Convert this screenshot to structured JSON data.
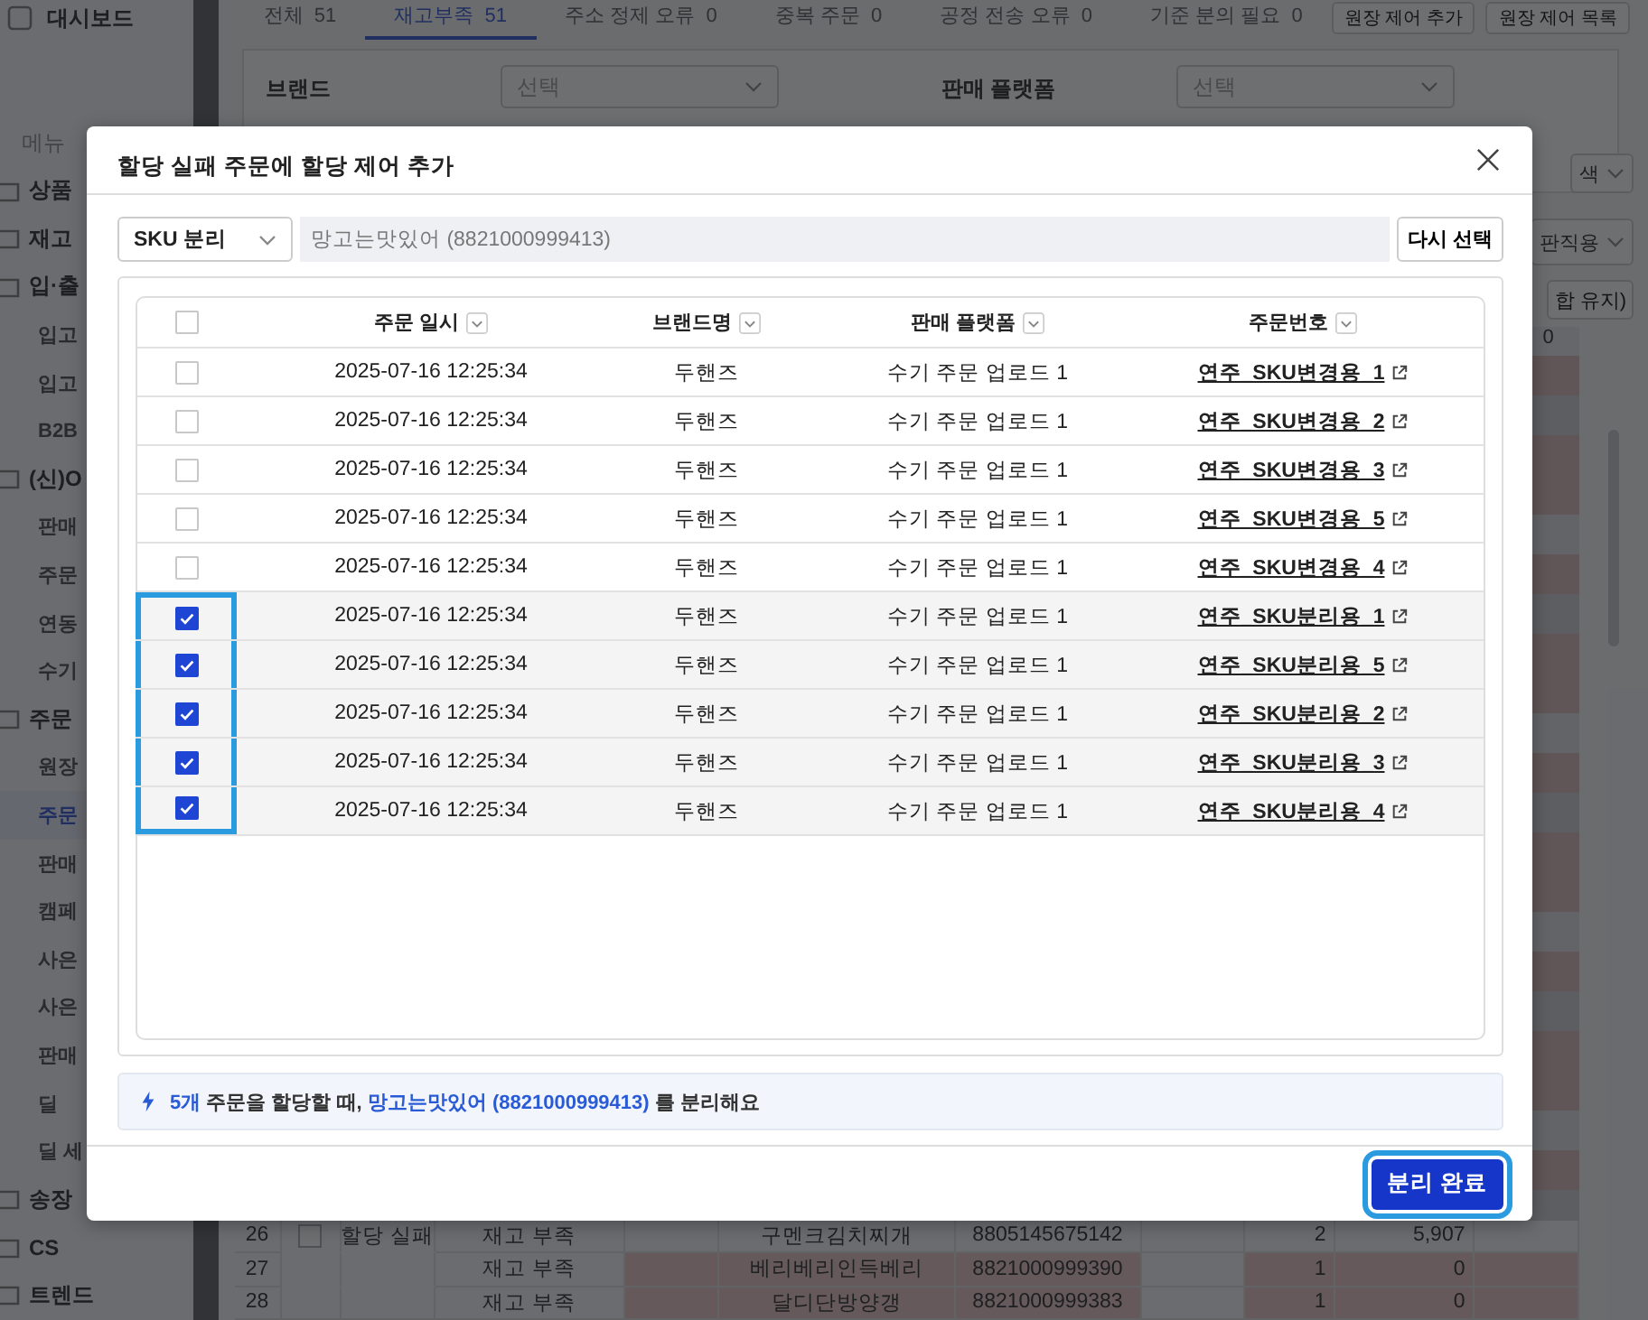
{
  "sidebar": {
    "items": [
      {
        "label": "대시보드",
        "kind": "top",
        "selected": false
      },
      {
        "label": "메뉴",
        "kind": "heading"
      },
      {
        "label": "상품",
        "kind": "section",
        "selected": false
      },
      {
        "label": "재고",
        "kind": "section",
        "selected": false
      },
      {
        "label": "입·출",
        "kind": "section",
        "selected": false
      },
      {
        "label": "입고",
        "kind": "sub",
        "selected": false
      },
      {
        "label": "입고",
        "kind": "sub",
        "selected": false
      },
      {
        "label": "B2B",
        "kind": "sub",
        "selected": false
      },
      {
        "label": "(신)O",
        "kind": "section",
        "selected": false
      },
      {
        "label": "판매",
        "kind": "sub",
        "selected": false
      },
      {
        "label": "주문",
        "kind": "sub",
        "selected": false
      },
      {
        "label": "연동",
        "kind": "sub",
        "selected": false
      },
      {
        "label": "수기",
        "kind": "sub",
        "selected": false
      },
      {
        "label": "주문",
        "kind": "section",
        "selected": false
      },
      {
        "label": "원장",
        "kind": "sub",
        "selected": false
      },
      {
        "label": "주문",
        "kind": "sub",
        "selected": true
      },
      {
        "label": "판매",
        "kind": "sub",
        "selected": false
      },
      {
        "label": "캠페",
        "kind": "sub",
        "selected": false
      },
      {
        "label": "사은",
        "kind": "sub",
        "selected": false
      },
      {
        "label": "사은",
        "kind": "sub",
        "selected": false
      },
      {
        "label": "판매",
        "kind": "sub",
        "selected": false
      },
      {
        "label": "딜",
        "kind": "sub",
        "selected": false
      },
      {
        "label": "딜 세",
        "kind": "sub",
        "selected": false
      },
      {
        "label": "송장",
        "kind": "section",
        "selected": false
      },
      {
        "label": "CS",
        "kind": "section",
        "selected": false
      },
      {
        "label": "트렌드",
        "kind": "section",
        "selected": false
      }
    ]
  },
  "tabs": [
    {
      "label": "전체",
      "count": "51",
      "selected": false
    },
    {
      "label": "재고부족",
      "count": "51",
      "selected": true
    },
    {
      "label": "주소 정제 오류",
      "count": "0",
      "selected": false
    },
    {
      "label": "중복 주문",
      "count": "0",
      "selected": false
    },
    {
      "label": "공정 전송 오류",
      "count": "0",
      "selected": false
    },
    {
      "label": "기준 분의 필요",
      "count": "0",
      "selected": false
    }
  ],
  "header_buttons": [
    "원장 제어 추가",
    "원장 제어 목록"
  ],
  "filters": [
    {
      "label": "브랜드",
      "placeholder": "선택"
    },
    {
      "label": "판매 플랫폼",
      "placeholder": "선택"
    }
  ],
  "side_controls": {
    "search_select": "색",
    "sort_select": "판직용",
    "merge_button": "합 유지)",
    "column_header": "0"
  },
  "background_rows": [
    {
      "no": "26",
      "checked": false,
      "status": "할당 실패",
      "reason": "재고 부족",
      "product": "구멘크김치찌개",
      "barcode": "8805145675142",
      "qty": "2",
      "stock": "5,907",
      "highlighted": false
    },
    {
      "no": "27",
      "status": "",
      "reason": "재고 부족",
      "product": "베리베리인득베리",
      "barcode": "8821000999390",
      "qty": "1",
      "stock": "0",
      "highlighted": true
    },
    {
      "no": "28",
      "status": "",
      "reason": "재고 부족",
      "product": "달디단방양갱",
      "barcode": "8821000999383",
      "qty": "1",
      "stock": "0",
      "highlighted": true
    }
  ],
  "modal": {
    "title": "할당 실패 주문에 할당 제어 추가",
    "mode_select": "SKU 분리",
    "product_field": "망고는맛있어 (8821000999413)",
    "reselect_button": "다시 선택",
    "table": {
      "select_all": {
        "checked": false
      },
      "columns": [
        "주문 일시",
        "브랜드명",
        "판매 플랫폼",
        "주문번호"
      ],
      "rows": [
        {
          "checked": false,
          "date": "2025-07-16 12:25:34",
          "brand": "두핸즈",
          "platform": "수기 주문 업로드 1",
          "order": "연주_SKU변경용_1"
        },
        {
          "checked": false,
          "date": "2025-07-16 12:25:34",
          "brand": "두핸즈",
          "platform": "수기 주문 업로드 1",
          "order": "연주_SKU변경용_2"
        },
        {
          "checked": false,
          "date": "2025-07-16 12:25:34",
          "brand": "두핸즈",
          "platform": "수기 주문 업로드 1",
          "order": "연주_SKU변경용_3"
        },
        {
          "checked": false,
          "date": "2025-07-16 12:25:34",
          "brand": "두핸즈",
          "platform": "수기 주문 업로드 1",
          "order": "연주_SKU변경용_5"
        },
        {
          "checked": false,
          "date": "2025-07-16 12:25:34",
          "brand": "두핸즈",
          "platform": "수기 주문 업로드 1",
          "order": "연주_SKU변경용_4"
        },
        {
          "checked": true,
          "date": "2025-07-16 12:25:34",
          "brand": "두핸즈",
          "platform": "수기 주문 업로드 1",
          "order": "연주_SKU분리용_1"
        },
        {
          "checked": true,
          "date": "2025-07-16 12:25:34",
          "brand": "두핸즈",
          "platform": "수기 주문 업로드 1",
          "order": "연주_SKU분리용_5"
        },
        {
          "checked": true,
          "date": "2025-07-16 12:25:34",
          "brand": "두핸즈",
          "platform": "수기 주문 업로드 1",
          "order": "연주_SKU분리용_2"
        },
        {
          "checked": true,
          "date": "2025-07-16 12:25:34",
          "brand": "두핸즈",
          "platform": "수기 주문 업로드 1",
          "order": "연주_SKU분리용_3"
        },
        {
          "checked": true,
          "date": "2025-07-16 12:25:34",
          "brand": "두핸즈",
          "platform": "수기 주문 업로드 1",
          "order": "연주_SKU분리용_4"
        }
      ]
    },
    "info": [
      {
        "text": "5개",
        "kind": "count"
      },
      {
        "text": " 주문을 할당할 때, ",
        "kind": "plain"
      },
      {
        "text": "망고는맛있어 (8821000999413)",
        "kind": "product"
      },
      {
        "text": " 를 분리해요",
        "kind": "plain"
      }
    ],
    "confirm_button": "분리 완료"
  }
}
